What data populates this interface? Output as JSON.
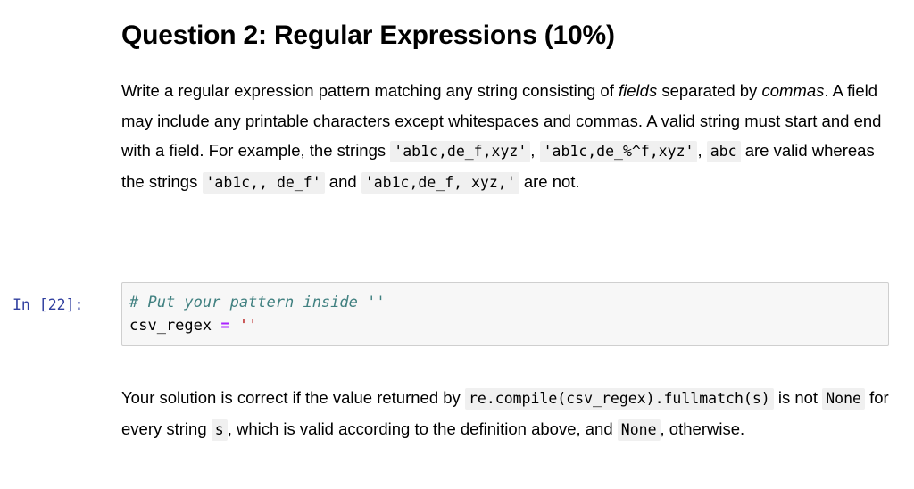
{
  "document": {
    "title": "Question 2: Regular Expressions (10%)",
    "intro": {
      "seg1": "Write a regular expression pattern matching any string consisting of ",
      "em1": "fields",
      "seg2": " separated by ",
      "em2": "commas",
      "seg3": ". A field may include any printable characters except whitespaces and commas. A valid string must start and end with a field. For example, the strings ",
      "code1": "'ab1c,de_f,xyz'",
      "seg4": ", ",
      "code2": "'ab1c,de_%^f,xyz'",
      "seg5": ", ",
      "code3": "abc",
      "seg6": " are valid whereas the strings ",
      "code4": "'ab1c,, de_f'",
      "seg7": " and ",
      "code5": "'ab1c,de_f, xyz,'",
      "seg8": " are not."
    },
    "solution_note": {
      "seg1": "Your solution is correct if the value returned by ",
      "code1": "re.compile(csv_regex).fullmatch(s)",
      "seg2": " is not ",
      "code2": "None",
      "seg3": " for every string ",
      "code3": "s",
      "seg4": ", which is valid according to the definition above, and ",
      "code4": "None",
      "seg5": ", otherwise."
    }
  },
  "code_cell": {
    "prompt": "In [22]:",
    "line1": {
      "comment": "# Put your pattern inside ''"
    },
    "line2": {
      "name": "csv_regex",
      "operator": "=",
      "string": "''"
    }
  },
  "colors": {
    "comment": "#408080",
    "operator": "#aa22ff",
    "string": "#ba2121",
    "prompt": "#303f9f",
    "cell_background": "#f7f7f7",
    "cell_border": "#cfcfcf",
    "inline_code_background": "#f0f0f0"
  }
}
